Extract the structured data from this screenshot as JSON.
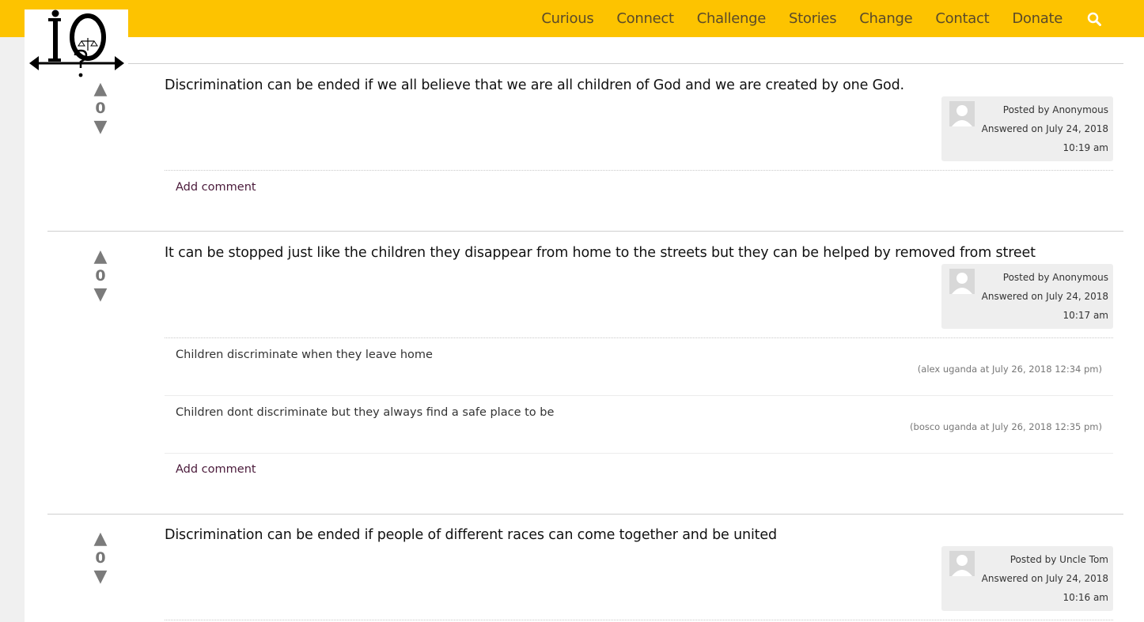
{
  "nav": {
    "items": [
      "Curious",
      "Connect",
      "Challenge",
      "Stories",
      "Change",
      "Contact",
      "Donate"
    ],
    "search_icon": "search-icon"
  },
  "logo": {
    "icon": "io-logo-with-scales-and-question-mark"
  },
  "answers": [
    {
      "votes": "0",
      "text": "Discrimination can be ended if we all believe that we are all children of God and we are created by one God.",
      "posted_by": "Posted by Anonymous",
      "answered_on": "Answered on July 24, 2018",
      "time": "10:19 am",
      "comments": [],
      "add_comment": "Add comment"
    },
    {
      "votes": "0",
      "text": "It can be stopped just like the children they disappear from home to the streets but they can be helped by removed from street",
      "posted_by": "Posted by Anonymous",
      "answered_on": "Answered on July 24, 2018",
      "time": "10:17 am",
      "comments": [
        {
          "text": "Children discriminate when they leave home",
          "meta": "(alex uganda at July 26, 2018 12:34 pm)"
        },
        {
          "text": "Children dont discriminate but they always find a safe place to be",
          "meta": "(bosco uganda at July 26, 2018 12:35 pm)"
        }
      ],
      "add_comment": "Add comment"
    },
    {
      "votes": "0",
      "text": "Discrimination can be ended if people of different races can come together and be united",
      "posted_by": "Posted by Uncle Tom",
      "answered_on": "Answered on July 24, 2018",
      "time": "10:16 am",
      "comments": [],
      "add_comment": ""
    }
  ],
  "colors": {
    "header": "#fdc300",
    "background": "#f0f0f0",
    "meta_box": "#eeeeee",
    "link": "#4a1a3a"
  }
}
